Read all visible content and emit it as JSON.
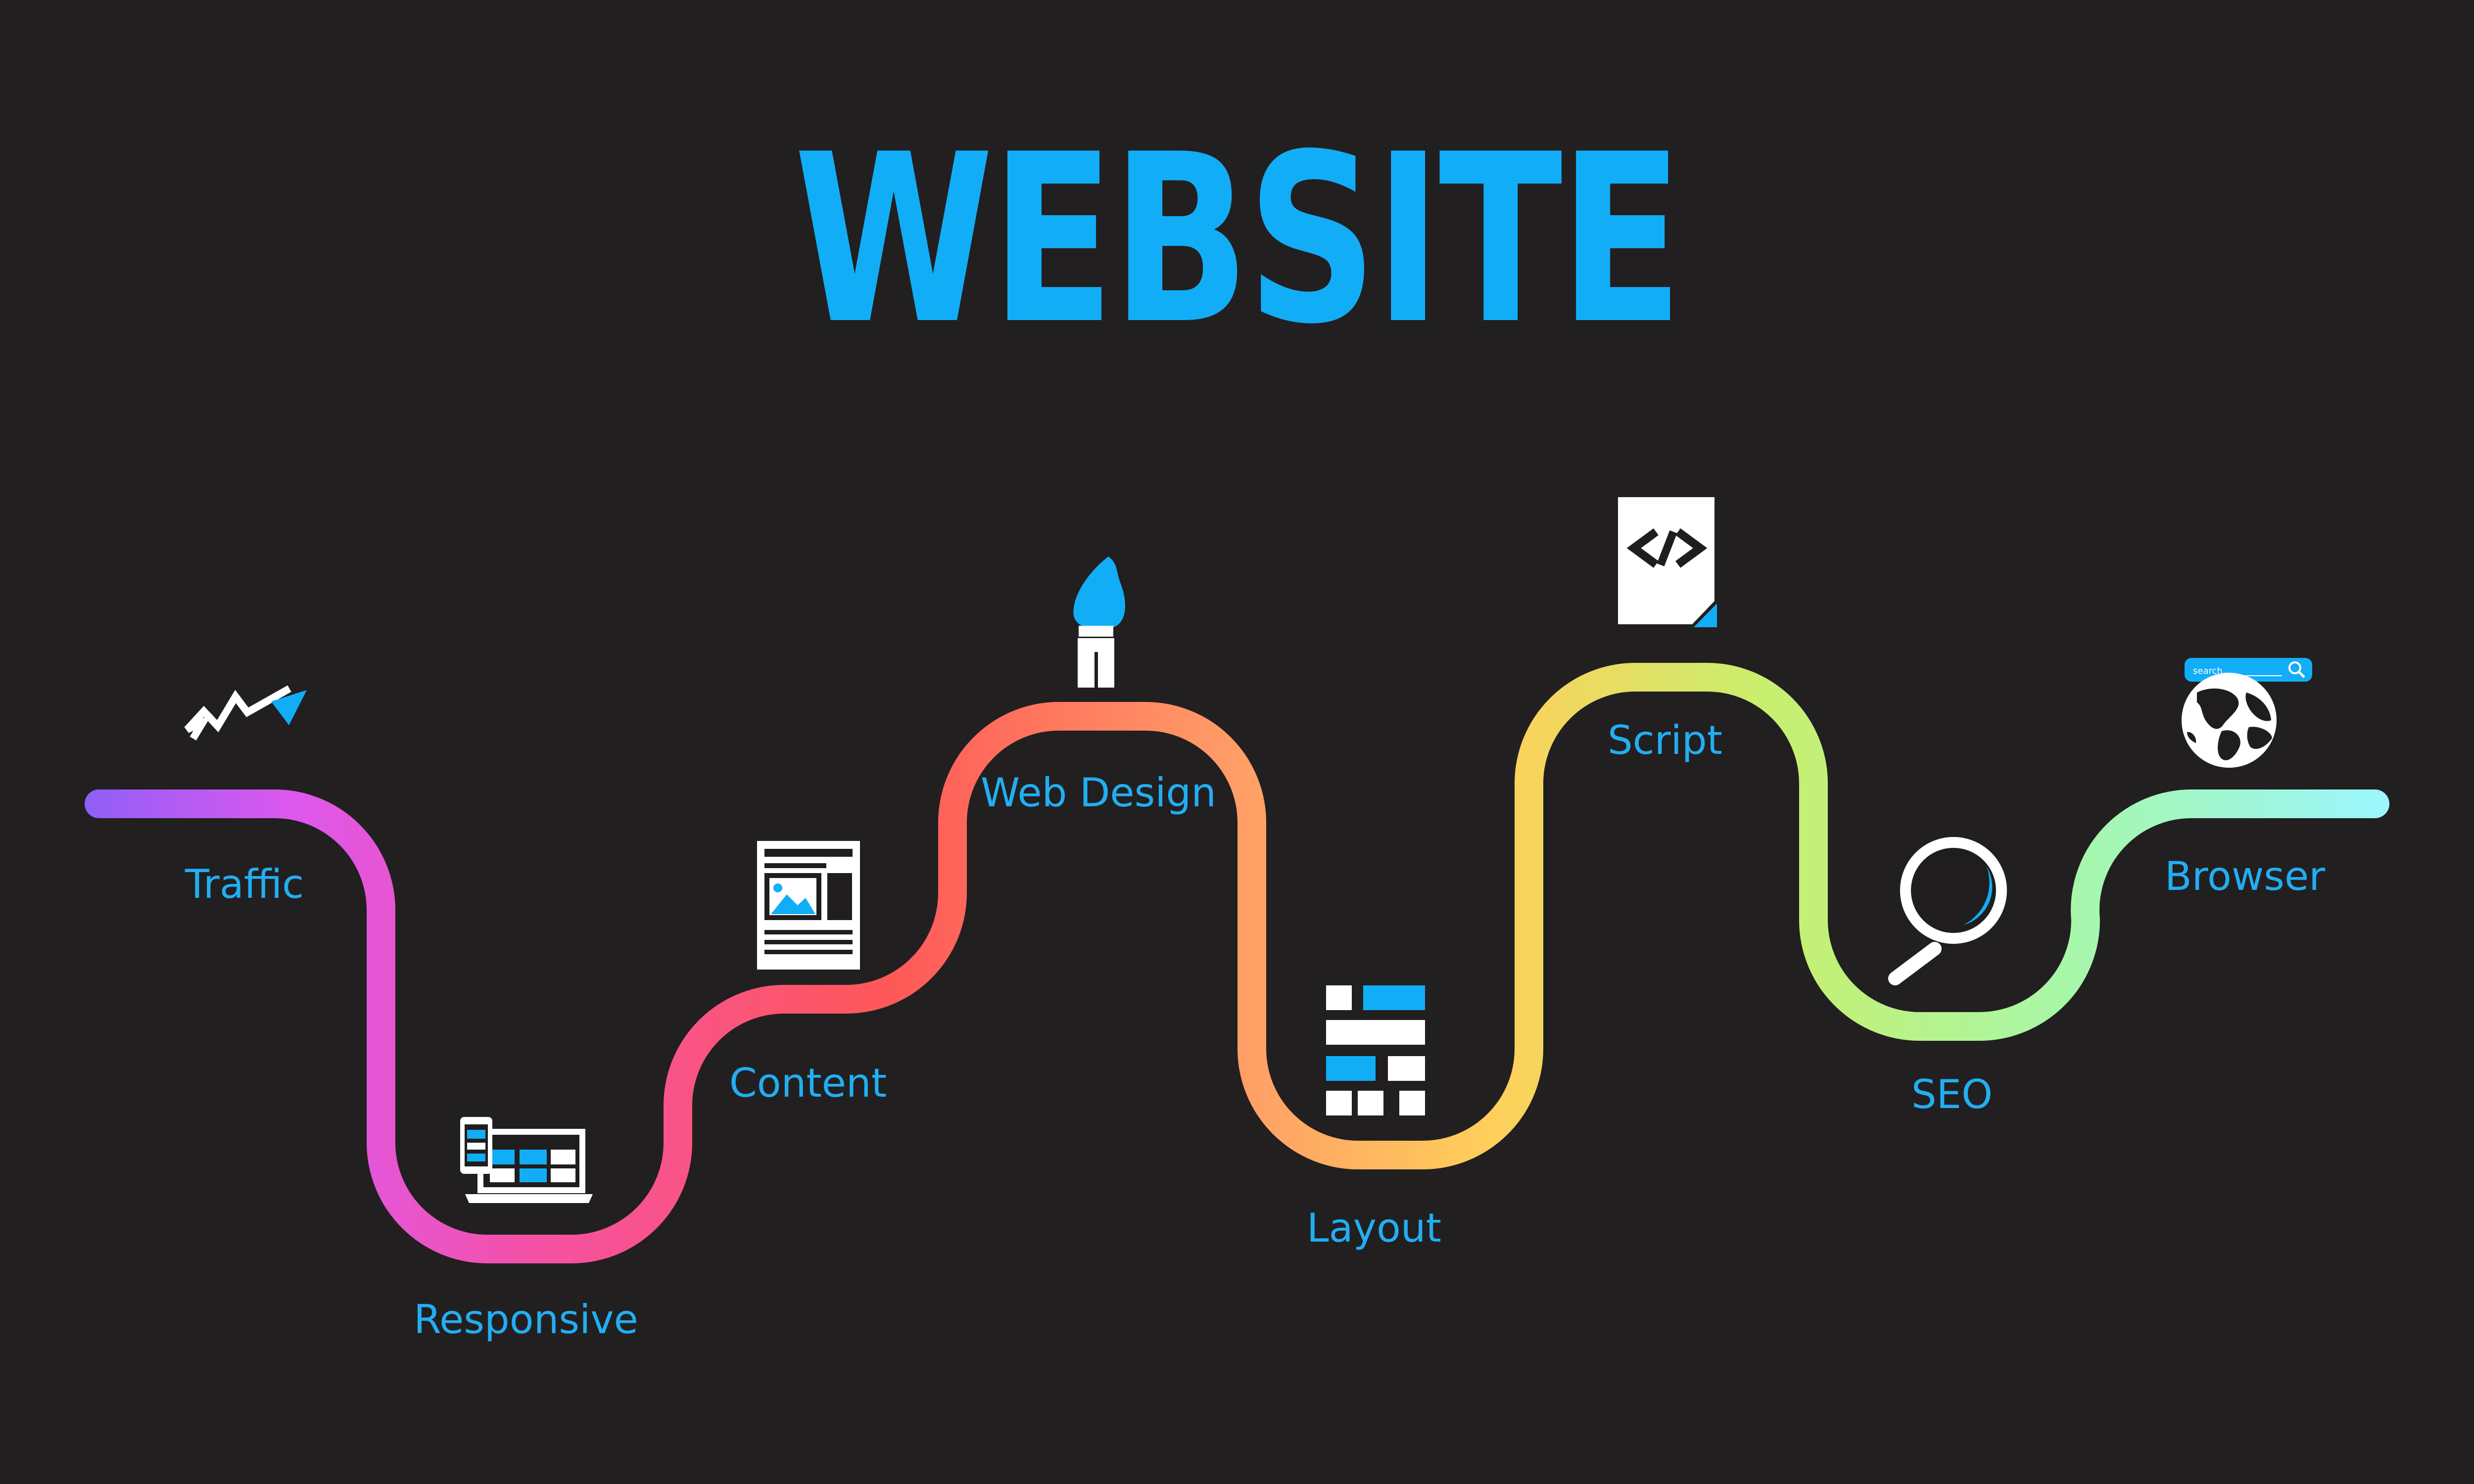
{
  "title": "WEBSITE",
  "colors": {
    "background": "#221f20",
    "accent": "#12adf7",
    "icon": "#ffffff",
    "path_gradient": [
      "#8f5ff7",
      "#dd58ef",
      "#f551a3",
      "#ff5858",
      "#ff9d67",
      "#ffcf5a",
      "#c8ef6e",
      "#a7f7a8",
      "#9bf6ff"
    ]
  },
  "steps": [
    {
      "label": "Traffic",
      "icon": "trend-arrow-icon"
    },
    {
      "label": "Responsive",
      "icon": "devices-icon"
    },
    {
      "label": "Content",
      "icon": "article-icon"
    },
    {
      "label": "Web Design",
      "icon": "paintbrush-icon"
    },
    {
      "label": "Layout",
      "icon": "layout-grid-icon"
    },
    {
      "label": "Script",
      "icon": "code-file-icon"
    },
    {
      "label": "SEO",
      "icon": "magnifier-icon"
    },
    {
      "label": "Browser",
      "icon": "globe-search-icon",
      "search_text": "search..."
    }
  ]
}
